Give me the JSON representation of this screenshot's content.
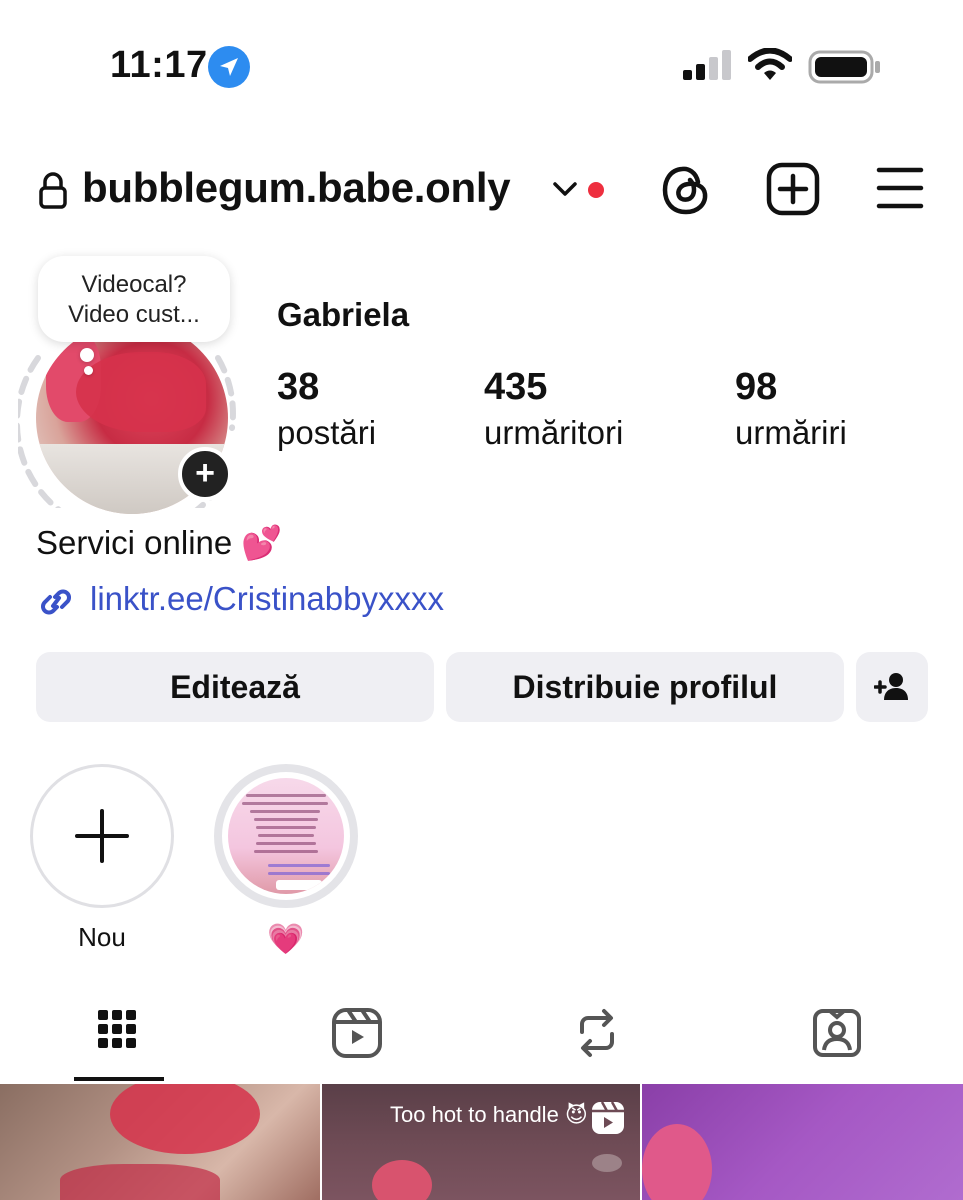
{
  "status_bar": {
    "time": "11:17"
  },
  "header": {
    "username": "bubblegum.babe.only"
  },
  "profile": {
    "note_line1": "Videocal?",
    "note_line2": "Video cust...",
    "display_name": "Gabriela",
    "stats": [
      {
        "value": "38",
        "label": "postări"
      },
      {
        "value": "435",
        "label": "urmăritori"
      },
      {
        "value": "98",
        "label": "urmăriri"
      }
    ],
    "bio": "Servici online 💕",
    "link": "linktr.ee/Cristinabbyxxxx"
  },
  "buttons": {
    "edit": "Editează",
    "share": "Distribuie profilul"
  },
  "highlights": [
    {
      "label": "Nou"
    },
    {
      "label": "💗"
    }
  ],
  "posts": [
    {
      "overlay": ""
    },
    {
      "overlay": "Too hot to handle 😈"
    },
    {
      "overlay": ""
    }
  ],
  "colors": {
    "link": "#3a52c8",
    "notification_dot": "#ee2f3f",
    "location_badge": "#2d8cf0",
    "button_bg": "#efeff3"
  },
  "icons": [
    "location-arrow-icon",
    "signal-icon",
    "wifi-icon",
    "battery-icon",
    "lock-icon",
    "chevron-down-icon",
    "threads-icon",
    "create-plus-icon",
    "menu-icon",
    "add-story-icon",
    "link-icon",
    "add-person-icon",
    "plus-icon",
    "grid-icon",
    "reels-icon",
    "reposts-icon",
    "tagged-icon",
    "reel-badge-icon"
  ]
}
